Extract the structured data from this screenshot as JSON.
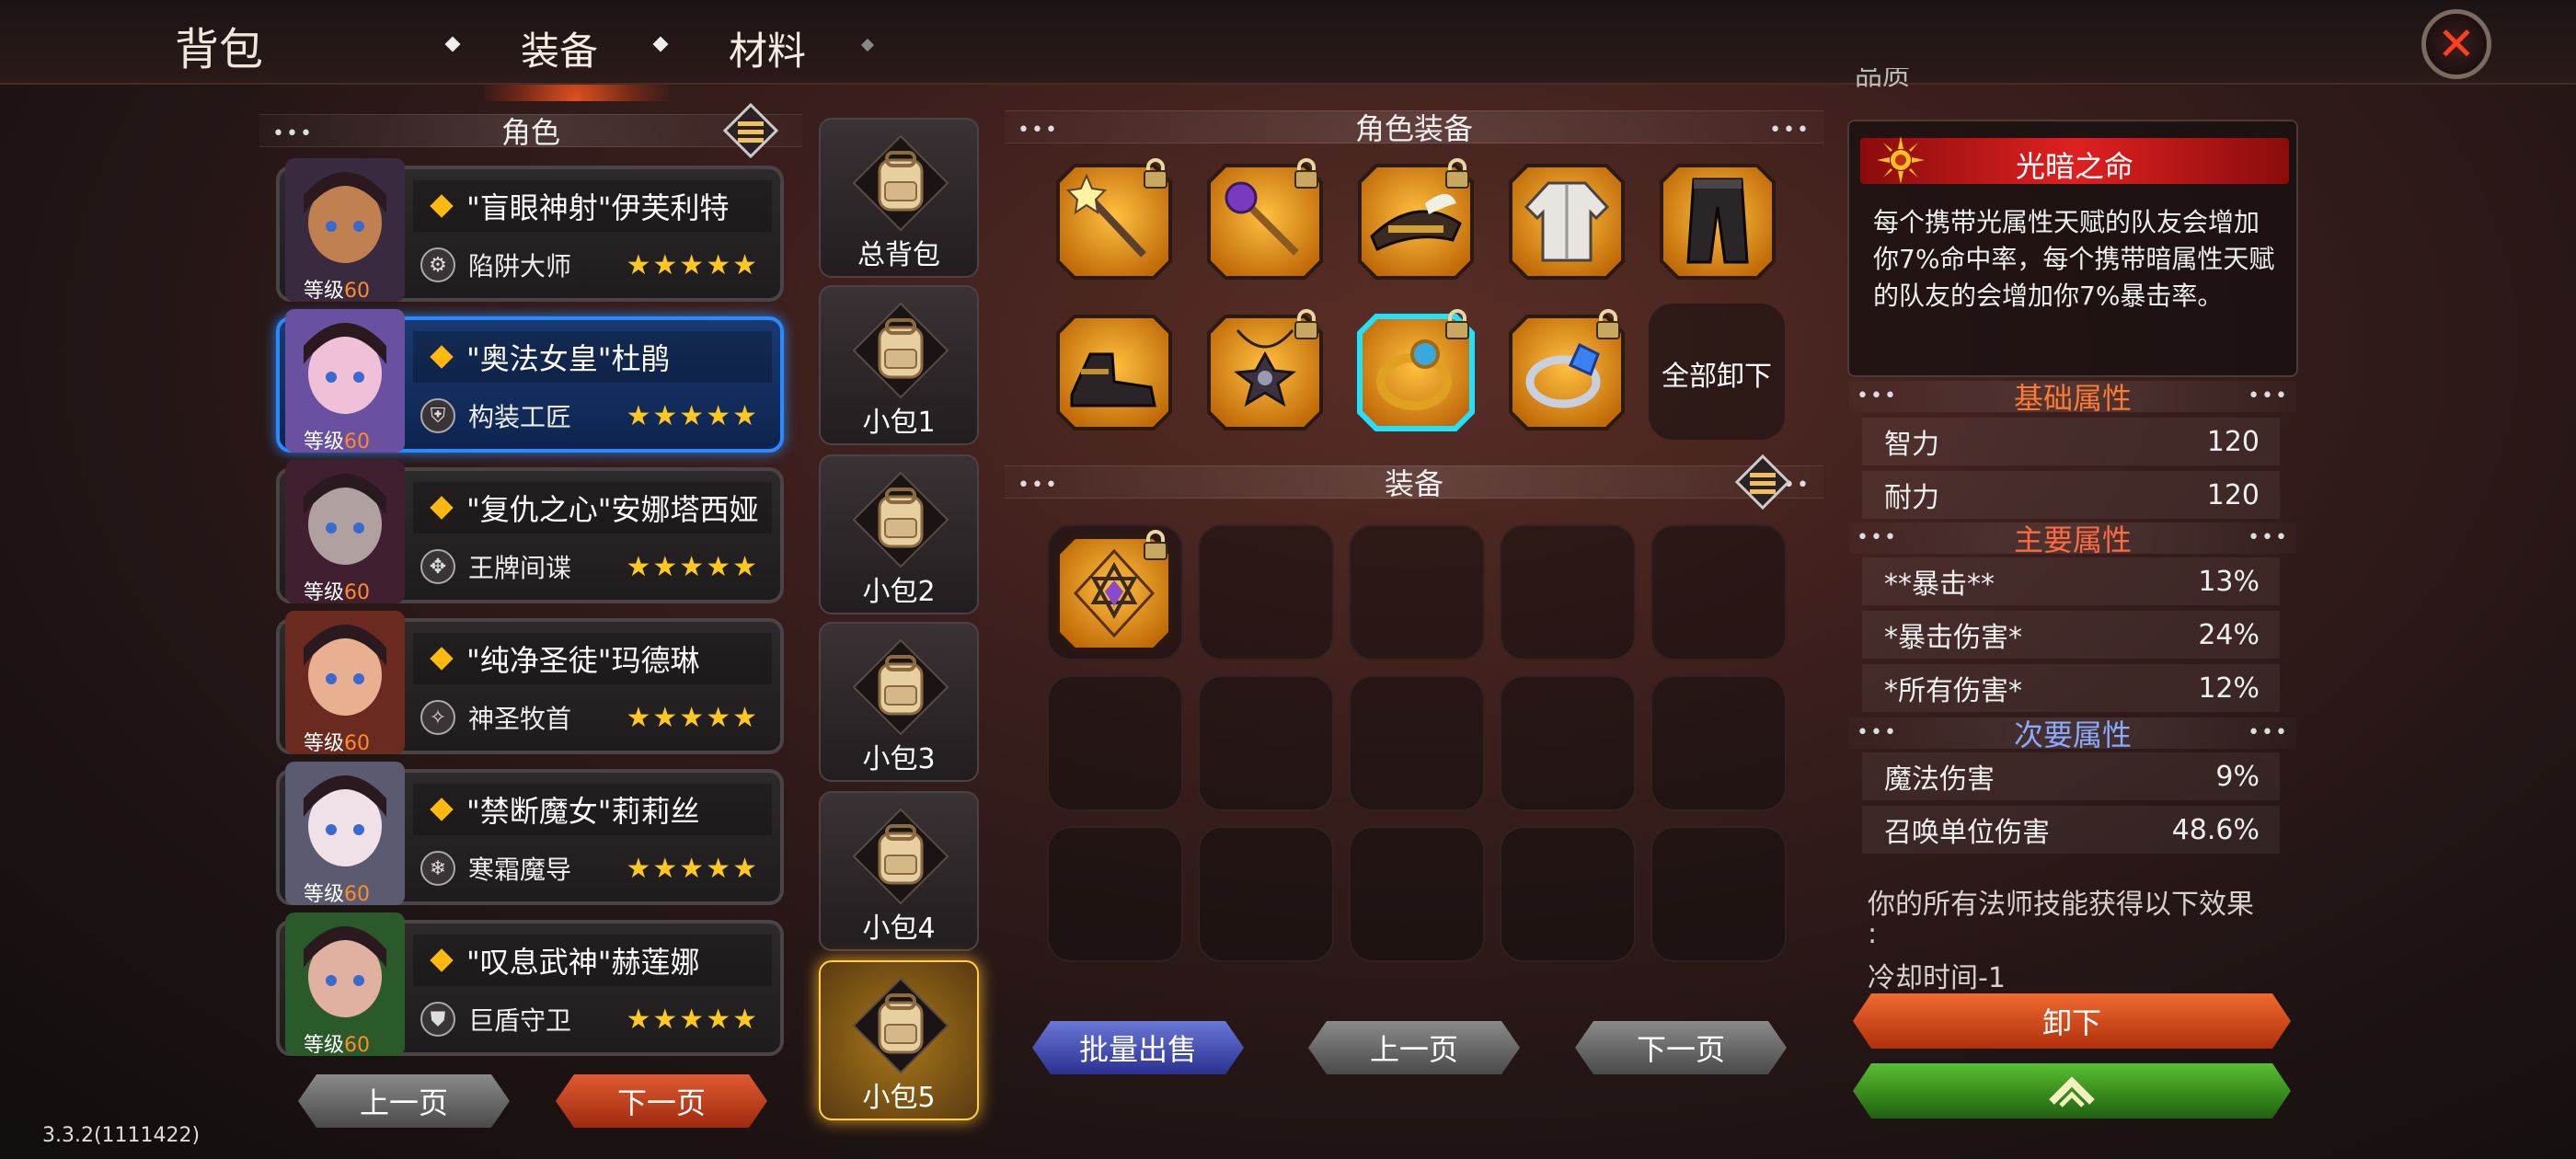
{
  "header": {
    "title": "背包",
    "tabs": [
      {
        "label": "装备",
        "active": true
      },
      {
        "label": "材料",
        "active": false
      }
    ],
    "close_icon": "close-x-icon"
  },
  "roles_panel": {
    "title": "角色",
    "characters": [
      {
        "name": "\"盲眼神射\"伊芙利特",
        "class": "陷阱大师",
        "level_label": "等级",
        "level": "60",
        "stars": "★★★★★",
        "selected": false
      },
      {
        "name": "\"奥法女皇\"杜鹃",
        "class": "构装工匠",
        "level_label": "等级",
        "level": "60",
        "stars": "★★★★★",
        "selected": true
      },
      {
        "name": "\"复仇之心\"安娜塔西娅",
        "class": "王牌间谍",
        "level_label": "等级",
        "level": "60",
        "stars": "★★★★★",
        "selected": false
      },
      {
        "name": "\"纯净圣徒\"玛德琳",
        "class": "神圣牧首",
        "level_label": "等级",
        "level": "60",
        "stars": "★★★★★",
        "selected": false
      },
      {
        "name": "\"禁断魔女\"莉莉丝",
        "class": "寒霜魔导",
        "level_label": "等级",
        "level": "60",
        "stars": "★★★★★",
        "selected": false
      },
      {
        "name": "\"叹息武神\"赫莲娜",
        "class": "巨盾守卫",
        "level_label": "等级",
        "level": "60",
        "stars": "★★★★★",
        "selected": false
      }
    ],
    "prev_label": "上一页",
    "next_label": "下一页"
  },
  "bags": [
    {
      "label": "总背包",
      "selected": false
    },
    {
      "label": "小包1",
      "selected": false
    },
    {
      "label": "小包2",
      "selected": false
    },
    {
      "label": "小包3",
      "selected": false
    },
    {
      "label": "小包4",
      "selected": false
    },
    {
      "label": "小包5",
      "selected": true
    }
  ],
  "char_equip": {
    "title": "角色装备",
    "items": [
      {
        "icon": "star-wand-icon",
        "locked": true
      },
      {
        "icon": "orb-staff-icon",
        "locked": true
      },
      {
        "icon": "feathered-hat-icon",
        "locked": true
      },
      {
        "icon": "robe-icon",
        "locked": false
      },
      {
        "icon": "pants-icon",
        "locked": false
      },
      {
        "icon": "boots-icon",
        "locked": false
      },
      {
        "icon": "amulet-icon",
        "locked": true
      },
      {
        "icon": "gold-ring-icon",
        "locked": true,
        "selected": true
      },
      {
        "icon": "sapphire-ring-icon",
        "locked": true
      }
    ],
    "unequip_all_label": "全部卸下"
  },
  "inventory": {
    "title": "装备",
    "items": [
      {
        "icon": "hexagram-gem-icon",
        "locked": true
      }
    ],
    "batch_sell_label": "批量出售",
    "prev_label": "上一页",
    "next_label": "下一页"
  },
  "detail": {
    "quality_partial": "品质",
    "talent_name": "光暗之命",
    "talent_desc": "每个携带光属性天赋的队友会增加你7%命中率，每个携带暗属性天赋的队友的会增加你7%暴击率。",
    "base_title": "基础属性",
    "base_stats": [
      {
        "name": "智力",
        "value": "120"
      },
      {
        "name": "耐力",
        "value": "120"
      }
    ],
    "main_title": "主要属性",
    "main_stats": [
      {
        "name": "**暴击**",
        "value": "13%"
      },
      {
        "name": "*暴击伤害*",
        "value": "24%"
      },
      {
        "name": "*所有伤害*",
        "value": "12%"
      }
    ],
    "sub_title": "次要属性",
    "sub_stats": [
      {
        "name": "魔法伤害",
        "value": "9%"
      },
      {
        "name": "召唤单位伤害",
        "value": "48.6%"
      }
    ],
    "skill_line1": "你的所有法师技能获得以下效果",
    "skill_line2": ":",
    "skill_line3": "冷却时间-1",
    "unequip_label": "卸下",
    "upgrade_icon": "chevron-up-icon",
    "colors": {
      "base_title": "#ff7a30",
      "main_title": "#ff6a40",
      "sub_title": "#8aaaff"
    }
  },
  "version": "3.3.2(1111422)"
}
